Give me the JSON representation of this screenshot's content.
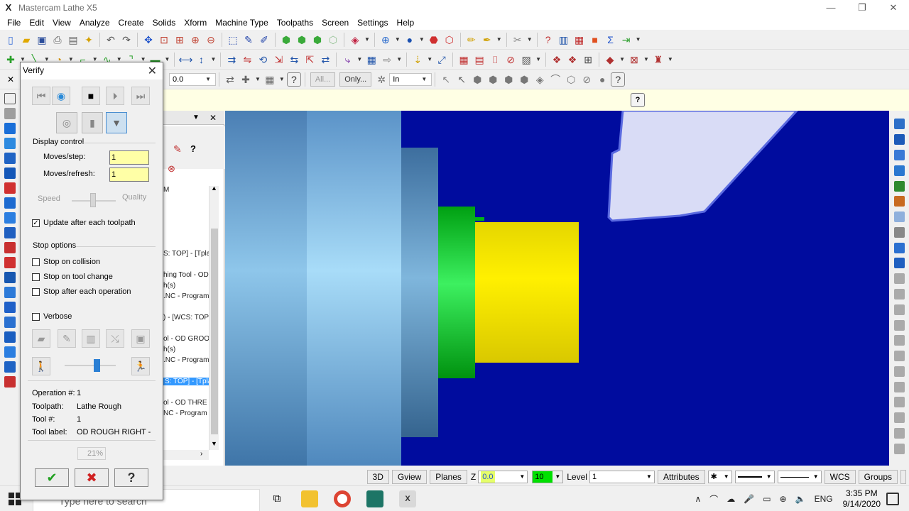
{
  "window": {
    "title": "Mastercam Lathe X5",
    "minimize": "—",
    "restore": "❐",
    "close": "✕",
    "app_glyph": "X"
  },
  "menu": [
    "File",
    "Edit",
    "View",
    "Analyze",
    "Create",
    "Solids",
    "Xform",
    "Machine Type",
    "Toolpaths",
    "Screen",
    "Settings",
    "Help"
  ],
  "toolbar3": {
    "z_value": "0.0",
    "all_label": "All...",
    "only_label": "Only...",
    "units_value": "In"
  },
  "ops_manager": {
    "lines": [
      "M",
      "S: TOP] - [Tpla",
      "hing Tool - OD",
      "h(s)",
      ".NC - Program",
      ") - [WCS: TOP",
      "ol - OD GROO",
      "h(s)",
      ".NC - Program",
      "S: TOP] - [Tpla",
      "ol - OD THRE",
      "NC - Program"
    ],
    "selected_index": 9
  },
  "verify": {
    "title": "Verify",
    "display_control": "Display control",
    "moves_step_label": "Moves/step:",
    "moves_step_value": "1",
    "moves_refresh_label": "Moves/refresh:",
    "moves_refresh_value": "1",
    "speed_label": "Speed",
    "quality_label": "Quality",
    "update_after_toolpath": {
      "label": "Update after each toolpath",
      "checked": true
    },
    "stop_options": "Stop options",
    "stop_on_collision": {
      "label": "Stop on collision",
      "checked": false
    },
    "stop_on_tool_change": {
      "label": "Stop on tool change",
      "checked": false
    },
    "stop_after_operation": {
      "label": "Stop after each operation",
      "checked": false
    },
    "verbose": {
      "label": "Verbose",
      "checked": false
    },
    "speed_slider_level": 0.62,
    "info": {
      "operation_label": "Operation #:",
      "operation_value": "1",
      "toolpath_label": "Toolpath:",
      "toolpath_value": "Lathe Rough",
      "tool_label": "Tool #:",
      "tool_value": "1",
      "tool_label_label": "Tool label:",
      "tool_label_value": "OD ROUGH RIGHT -"
    },
    "progress": "21%"
  },
  "statusbar": {
    "btn_3d": "3D",
    "btn_gview": "Gview",
    "btn_planes": "Planes",
    "z_label": "Z",
    "z_value": "0.0",
    "color_value": "10",
    "level_label": "Level",
    "level_value": "1",
    "attributes": "Attributes",
    "wcs": "WCS",
    "groups": "Groups"
  },
  "taskbar": {
    "search_placeholder": "Type here to search",
    "lang": "ENG",
    "time": "3:35 PM",
    "date": "9/14/2020"
  },
  "colors": {
    "graphics_bg": "#000c9e",
    "stock_light_blue": "#9fd0f2",
    "green_groove": "#00c21a",
    "yellow_part": "#f2e400",
    "tool_insert": "#d9dcf6",
    "field_yellow": "#ffffa6",
    "help_strip": "#ffffe4"
  }
}
